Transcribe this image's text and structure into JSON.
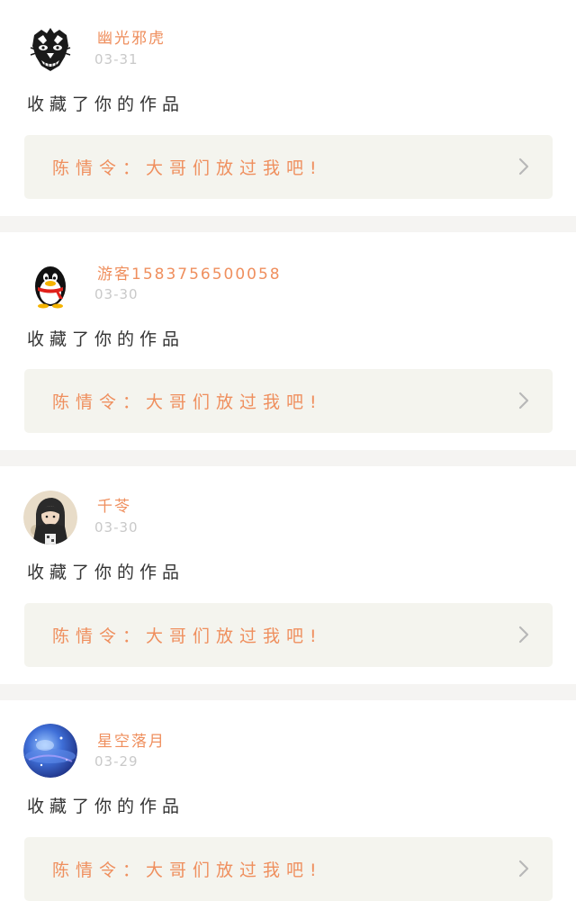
{
  "feed": {
    "items": [
      {
        "user_name": "幽光邪虎",
        "date": "03-31",
        "action": "收藏了你的作品",
        "work_title": "陈情令：大哥们放过我吧!",
        "avatar_icon": "tiger-head-avatar-icon"
      },
      {
        "user_name": "游客1583756500058",
        "date": "03-30",
        "action": "收藏了你的作品",
        "work_title": "陈情令：大哥们放过我吧!",
        "avatar_icon": "qq-penguin-avatar-icon"
      },
      {
        "user_name": "千苓",
        "date": "03-30",
        "action": "收藏了你的作品",
        "work_title": "陈情令：大哥们放过我吧!",
        "avatar_icon": "hooded-figure-avatar-icon"
      },
      {
        "user_name": "星空落月",
        "date": "03-29",
        "action": "收藏了你的作品",
        "work_title": "陈情令：大哥们放过我吧!",
        "avatar_icon": "blue-galaxy-avatar-icon"
      }
    ]
  },
  "colors": {
    "accent": "#ef8f5e",
    "date": "#c9c9c9",
    "text": "#333333",
    "link_bg": "#f4f4ee",
    "divider": "#f5f4f2",
    "chevron": "#b8b8b8"
  }
}
